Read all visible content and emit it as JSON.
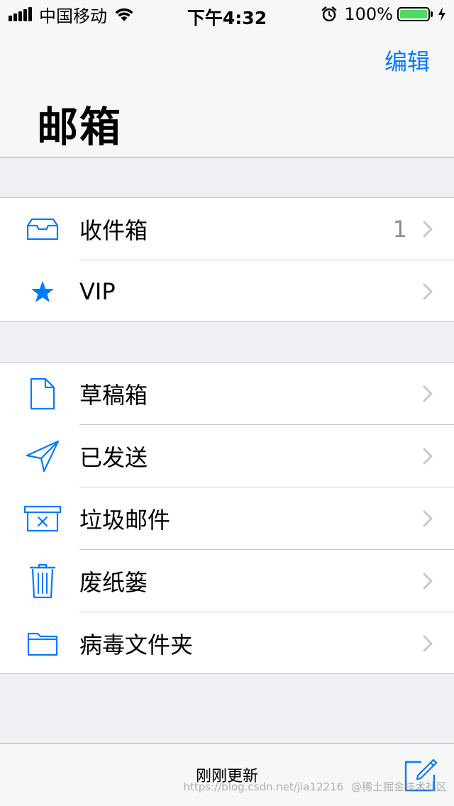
{
  "status_bar": {
    "carrier": "中国移动",
    "time": "下午4:32",
    "battery_percent": "100%",
    "battery_level": 1.0,
    "icons": [
      "signal-icon",
      "wifi-icon",
      "alarm-icon",
      "battery-icon",
      "charging-icon"
    ]
  },
  "nav": {
    "edit_label": "编辑",
    "title": "邮箱"
  },
  "groups": [
    {
      "items": [
        {
          "label": "收件箱",
          "count": "1",
          "icon": "inbox-icon"
        },
        {
          "label": "VIP",
          "count": "",
          "icon": "star-icon"
        }
      ]
    },
    {
      "items": [
        {
          "label": "草稿箱",
          "count": "",
          "icon": "draft-document-icon"
        },
        {
          "label": "已发送",
          "count": "",
          "icon": "paper-plane-icon"
        },
        {
          "label": "垃圾邮件",
          "count": "",
          "icon": "junk-box-icon"
        },
        {
          "label": "废纸篓",
          "count": "",
          "icon": "trash-icon"
        },
        {
          "label": "病毒文件夹",
          "count": "",
          "icon": "folder-icon"
        }
      ]
    }
  ],
  "toolbar": {
    "status": "刚刚更新",
    "compose_icon": "compose-icon"
  },
  "watermark": "https://blog.csdn.net/jia12216",
  "watermark2": "@稀土掘金技术社区",
  "colors": {
    "accent": "#007aff",
    "battery": "#4cd964",
    "background": "#efeff4",
    "chevron": "#c7c7cc"
  }
}
